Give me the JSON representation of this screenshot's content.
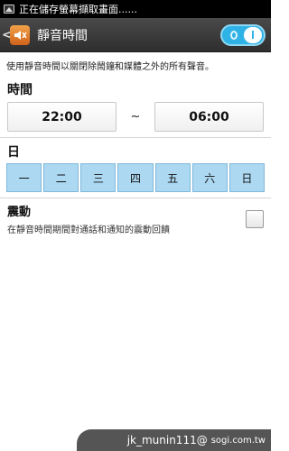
{
  "status_bar": {
    "notification": "正在儲存螢幕擷取畫面......",
    "icon": "image-icon"
  },
  "action_bar": {
    "back_icon": "<",
    "app_icon": "speaker-mute-icon",
    "title": "靜音時間",
    "toggle_on": true,
    "accent": "#2fb3e6"
  },
  "description": "使用靜音時間以關閉除鬧鐘和媒體之外的所有聲音。",
  "time_section": {
    "label": "時間",
    "start": "22:00",
    "separator": "~",
    "end": "06:00"
  },
  "day_section": {
    "label": "日",
    "days": [
      "一",
      "二",
      "三",
      "四",
      "五",
      "六",
      "日"
    ],
    "selected_color": "#acd8f2"
  },
  "vibration": {
    "title": "震動",
    "subtitle": "在靜音時間期間對通話和通知的震動回饋",
    "checked": false
  },
  "watermark": {
    "user": "jk_munin111@",
    "site": "sogi.com.tw"
  }
}
